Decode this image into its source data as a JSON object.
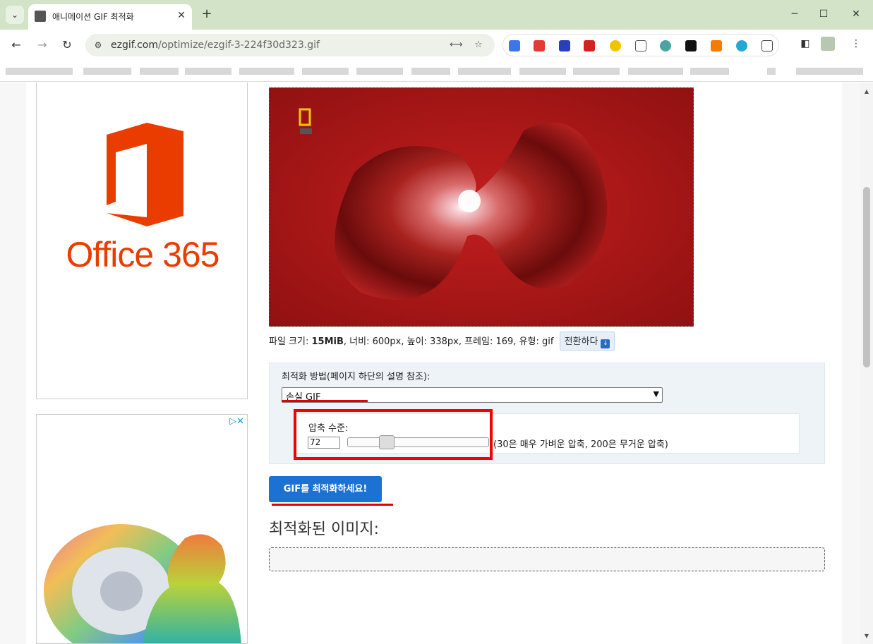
{
  "browser": {
    "tab_title": "애니메이션 GIF 최적화",
    "tab_close": "✕",
    "new_tab": "+",
    "url_host": "ezgif.com",
    "url_path": "/optimize/ezgif-3-224f30d323.gif",
    "window_controls": {
      "minimize": "─",
      "maximize": "☐",
      "close": "✕"
    },
    "nav": {
      "back": "←",
      "forward": "→",
      "reload": "↻"
    },
    "menu": "⋮"
  },
  "ads": {
    "ad1_brand": "Office 365",
    "adchoices": "▷✕"
  },
  "file_info": {
    "label_size": "파일 크기: ",
    "size": "15MiB",
    "rest": ", 너비: 600px, 높이: 338px, 프레임: 169, 유형: gif",
    "convert_label": "전환하다"
  },
  "options": {
    "method_label": "최적화 방법(페이지 하단의 설명 참조):",
    "method_value": "손실 GIF",
    "level_label": "압축 수준:",
    "level_value": "72",
    "level_note": "(30은 매우 가벼운 압축, 200은 무거운 압축)",
    "slider_min": 30,
    "slider_max": 200
  },
  "optimize_button": "GIF를 최적화하세요!",
  "result_heading": "최적화된 이미지:",
  "colors": {
    "accent_button": "#1b72d2",
    "annotation_red": "#f30000",
    "office_orange": "#eb3c00",
    "tabstrip": "#d3e3c7"
  }
}
